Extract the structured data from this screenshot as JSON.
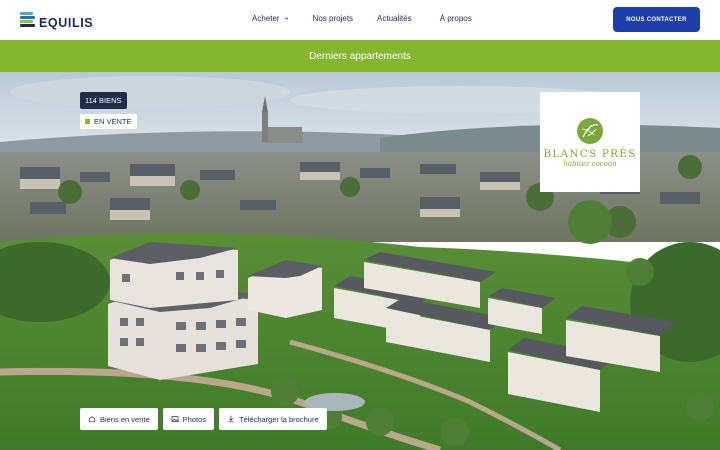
{
  "header": {
    "logo_text": "EQUILIS",
    "nav": [
      {
        "label": "Acheter",
        "has_dropdown": true
      },
      {
        "label": "Nos projets",
        "has_dropdown": false
      },
      {
        "label": "Actualités",
        "has_dropdown": false
      },
      {
        "label": "À propos",
        "has_dropdown": false
      }
    ],
    "cta_label": "NOUS CONTACTER"
  },
  "band": {
    "title": "Derniers appartements"
  },
  "project": {
    "count_badge": "114 BIENS",
    "status_badge": "EN VENTE",
    "brand_name": "BLANCS PRÉS",
    "brand_tagline": "habitez cocoon"
  },
  "actions": [
    {
      "label": "Biens en vente",
      "icon": "home-icon"
    },
    {
      "label": "Photos",
      "icon": "image-icon"
    },
    {
      "label": "Télécharger la brochure",
      "icon": "download-icon"
    }
  ],
  "colors": {
    "brand_navy": "#1f2d4c",
    "cta_blue": "#1e3eaa",
    "accent_green": "#86b52f",
    "logo_green": "#7aa83a"
  }
}
